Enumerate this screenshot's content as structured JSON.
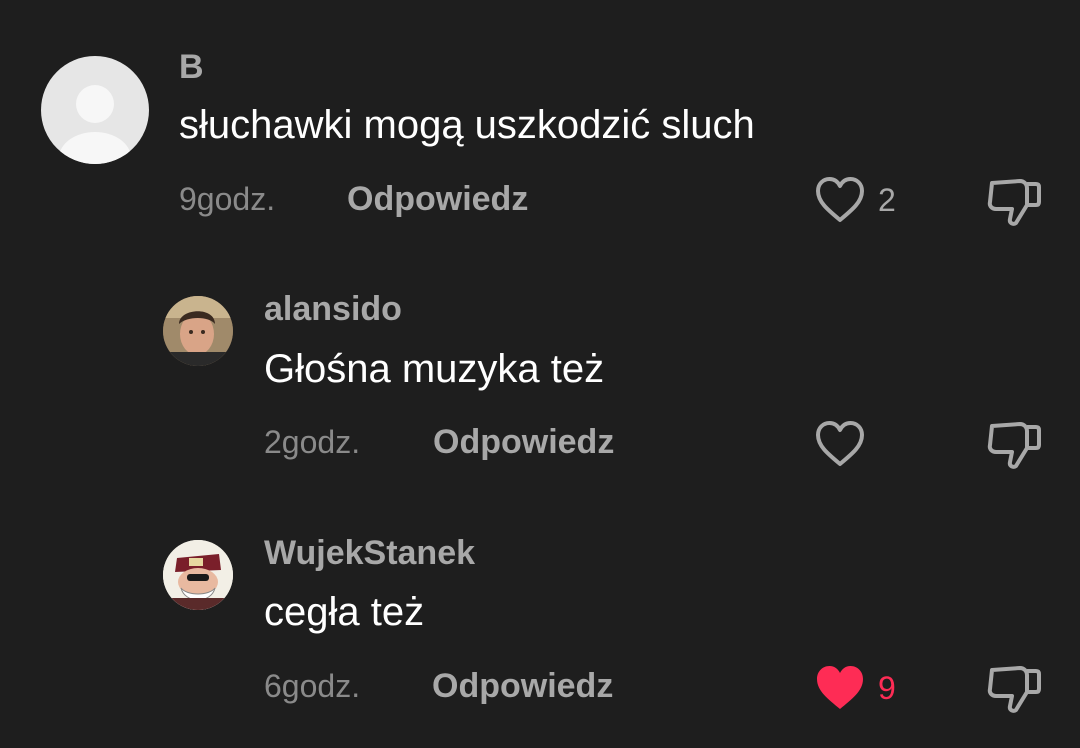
{
  "comments": [
    {
      "username": "B",
      "text": "słuchawki mogą uszkodzić sluch",
      "time": "9godz.",
      "reply_label": "Odpowiedz",
      "likes": "2",
      "liked": false
    },
    {
      "username": "alansido",
      "text": "Głośna muzyka też",
      "time": "2godz.",
      "reply_label": "Odpowiedz",
      "likes": "",
      "liked": false
    },
    {
      "username": "WujekStanek",
      "text": "cegła też",
      "time": "6godz.",
      "reply_label": "Odpowiedz",
      "likes": "9",
      "liked": true
    }
  ],
  "colors": {
    "background": "#1e1e1e",
    "liked_heart": "#fe2c55",
    "muted_text": "#a8a8a8"
  },
  "icons": {
    "like": "heart-icon",
    "dislike": "thumbs-down-icon",
    "default_avatar": "default-avatar-icon"
  }
}
